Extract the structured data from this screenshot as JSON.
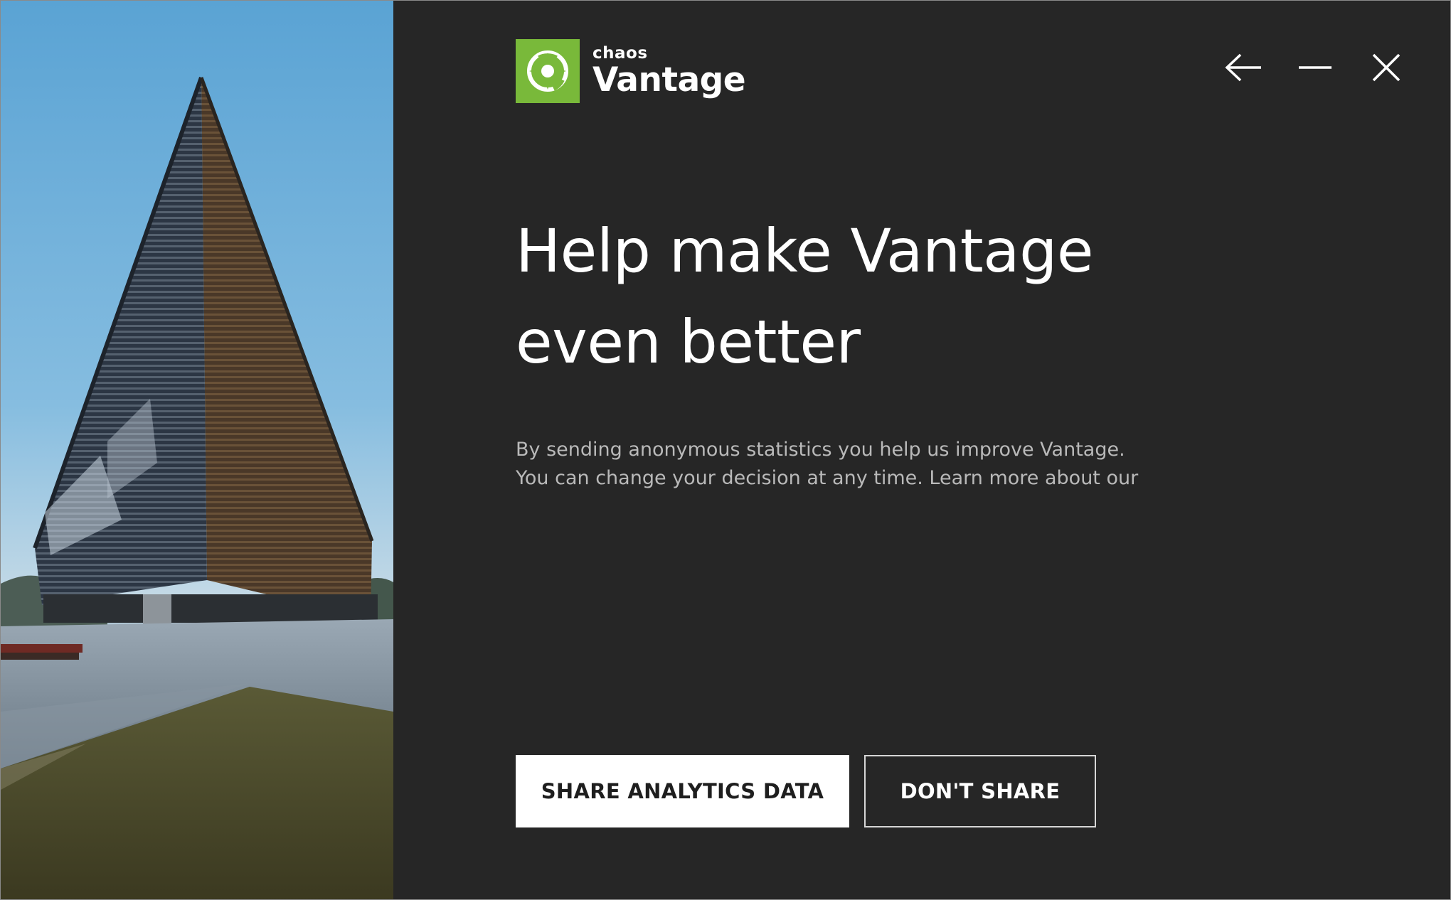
{
  "app": {
    "brand_small": "chaos",
    "brand_name": "Vantage",
    "brand_color": "#79b93a"
  },
  "window_controls": {
    "back_icon": "arrow-left-icon",
    "minimize_icon": "minimize-icon",
    "close_icon": "close-icon"
  },
  "main": {
    "headline_line1": "Help make Vantage",
    "headline_line2": "even better",
    "description_line1": "By sending anonymous statistics you help us improve Vantage.",
    "description_line2": "You can change your decision at any time. Learn more about our"
  },
  "actions": {
    "share_label": "SHARE ANALYTICS DATA",
    "dont_share_label": "DON'T SHARE"
  },
  "hero": {
    "image_name": "building-render-image"
  }
}
